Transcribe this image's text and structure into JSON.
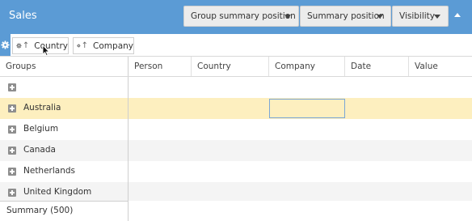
{
  "header": {
    "title": "Sales",
    "buttons": {
      "group_summary_position": "Group summary position",
      "summary_position": "Summary position",
      "visibility": "Visibility"
    },
    "background_color": "#5b9bd5"
  },
  "group_panel": {
    "chips": [
      {
        "label": "Country",
        "sort": "ascending"
      },
      {
        "label": "Company",
        "sort": "ascending"
      }
    ]
  },
  "grid": {
    "columns": [
      "Groups",
      "Person",
      "Country",
      "Company",
      "Date",
      "Value"
    ],
    "groups": [
      "",
      "Australia",
      "Belgium",
      "Canada",
      "Netherlands",
      "United Kingdom"
    ],
    "selected_group": "Australia",
    "selected_row_color": "#fdefbf",
    "summary": "Summary (500)"
  }
}
